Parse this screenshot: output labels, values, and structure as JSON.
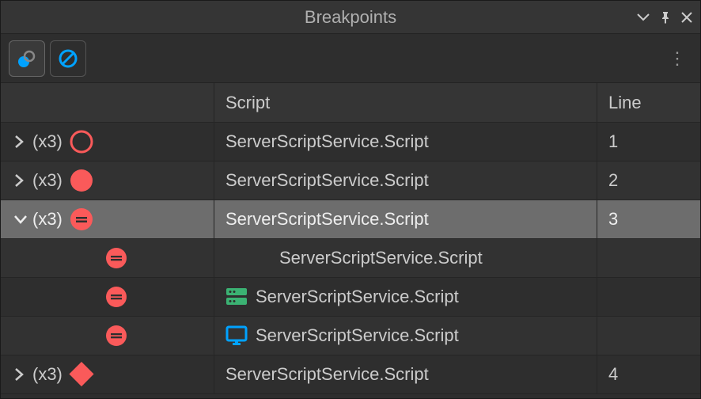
{
  "window": {
    "title": "Breakpoints"
  },
  "columns": {
    "c1": "",
    "c2": "Script",
    "c3": "Line"
  },
  "colors": {
    "red": "#fa5a5a",
    "green": "#3bb273",
    "blue": "#00a2ff",
    "text": "#cccccc"
  },
  "rows": [
    {
      "count": "(x3)",
      "script": "ServerScriptService.Script",
      "line": "1"
    },
    {
      "count": "(x3)",
      "script": "ServerScriptService.Script",
      "line": "2"
    },
    {
      "count": "(x3)",
      "script": "ServerScriptService.Script",
      "line": "3"
    },
    {
      "count": "(x3)",
      "script": "ServerScriptService.Script",
      "line": "4"
    }
  ],
  "children": [
    {
      "script": "ServerScriptService.Script"
    },
    {
      "script": "ServerScriptService.Script"
    },
    {
      "script": "ServerScriptService.Script"
    }
  ]
}
